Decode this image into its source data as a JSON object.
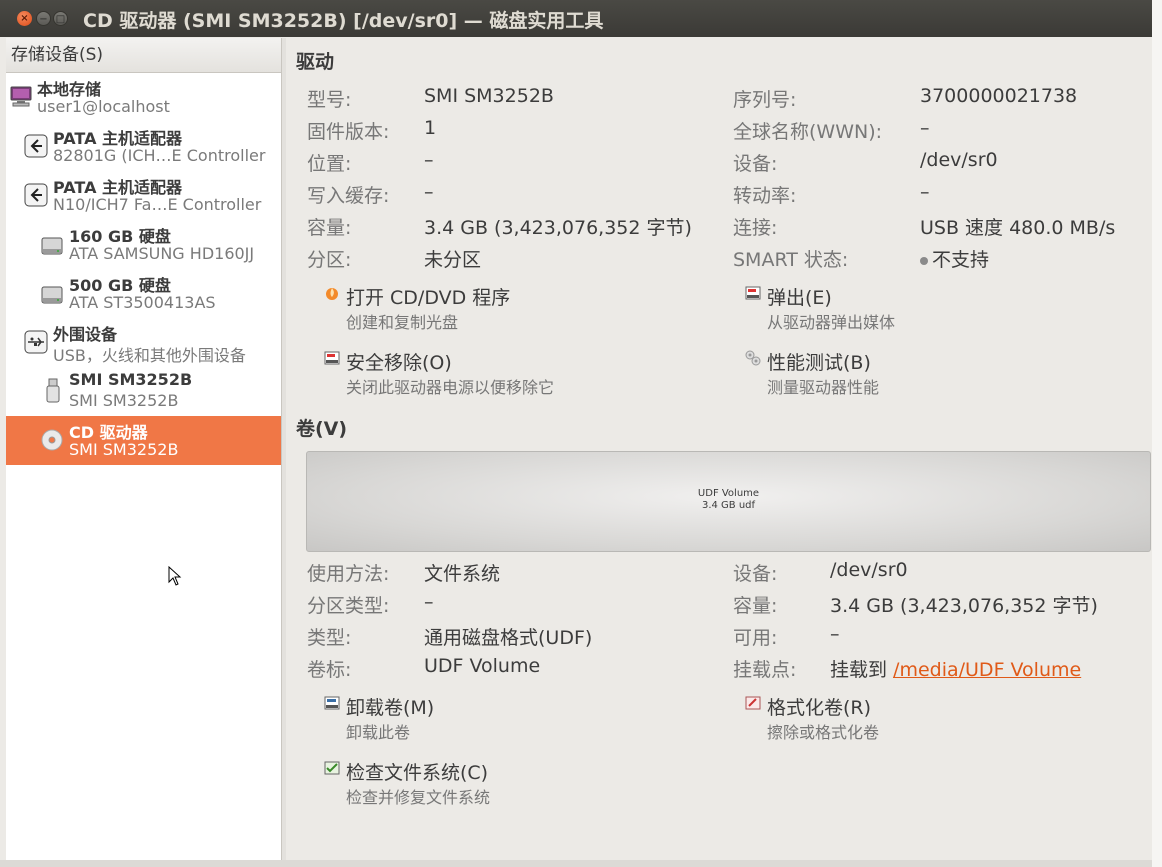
{
  "window": {
    "title": "CD 驱动器 (SMI SM3252B) [/dev/sr0] — 磁盘实用工具",
    "close": "×",
    "min": "−",
    "max": "□"
  },
  "sidebar": {
    "header": "存储设备(S)",
    "items": [
      {
        "title": "本地存储",
        "subtitle": "user1@localhost",
        "icon": "computer-icon"
      },
      {
        "title": "PATA 主机适配器",
        "subtitle": "82801G (ICH…E Controller",
        "icon": "adapter-icon"
      },
      {
        "title": "PATA 主机适配器",
        "subtitle": "N10/ICH7 Fa…E Controller",
        "icon": "adapter-icon"
      },
      {
        "title": "160 GB 硬盘",
        "subtitle": "ATA SAMSUNG HD160JJ",
        "icon": "harddisk-icon"
      },
      {
        "title": "500 GB 硬盘",
        "subtitle": "ATA ST3500413AS",
        "icon": "harddisk-icon"
      },
      {
        "title": "外围设备",
        "subtitle": "USB，火线和其他外围设备",
        "icon": "usb-icon"
      },
      {
        "title": "SMI SM3252B",
        "subtitle": "SMI SM3252B",
        "icon": "usb-stick-icon"
      },
      {
        "title": "CD 驱动器",
        "subtitle": "SMI SM3252B",
        "icon": "cdrom-icon",
        "selected": true
      }
    ]
  },
  "drive": {
    "section_title": "驱动",
    "model_label": "型号:",
    "model": "SMI SM3252B",
    "firmware_label": "固件版本:",
    "firmware": "1",
    "location_label": "位置:",
    "location": "–",
    "write_cache_label": "写入缓存:",
    "write_cache": "–",
    "capacity_label": "容量:",
    "capacity": "3.4 GB (3,423,076,352 字节)",
    "partitioning_label": "分区:",
    "partitioning": "未分区",
    "serial_label": "序列号:",
    "serial": "3700000021738",
    "wwn_label": "全球名称(WWN):",
    "wwn": "–",
    "device_label": "设备:",
    "device": "/dev/sr0",
    "rotation_label": "转动率:",
    "rotation": "–",
    "connection_label": "连接:",
    "connection": "USB 速度 480.0 MB/s",
    "smart_label": "SMART 状态:",
    "smart": "不支持",
    "actions": {
      "open_title": "打开 CD/DVD 程序",
      "open_desc": "创建和复制光盘",
      "eject_title": "弹出(E)",
      "eject_desc": "从驱动器弹出媒体",
      "safe_remove_title": "安全移除(O)",
      "safe_remove_desc": "关闭此驱动器电源以便移除它",
      "benchmark_title": "性能测试(B)",
      "benchmark_desc": "测量驱动器性能"
    }
  },
  "volume": {
    "section_title": "卷(V)",
    "bar_line1": "UDF Volume",
    "bar_line2": "3.4 GB udf",
    "usage_label": "使用方法:",
    "usage": "文件系统",
    "part_type_label": "分区类型:",
    "part_type": "–",
    "type_label": "类型:",
    "type": "通用磁盘格式(UDF)",
    "label_label": "卷标:",
    "label": "UDF Volume",
    "device_label": "设备:",
    "device": "/dev/sr0",
    "capacity_label": "容量:",
    "capacity": "3.4 GB (3,423,076,352 字节)",
    "available_label": "可用:",
    "available": "–",
    "mount_label": "挂载点:",
    "mount_prefix": "挂载到 ",
    "mount_link": "/media/UDF Volume",
    "actions": {
      "unmount_title": "卸载卷(M)",
      "unmount_desc": "卸载此卷",
      "format_title": "格式化卷(R)",
      "format_desc": "擦除或格式化卷",
      "check_title": "检查文件系统(C)",
      "check_desc": "检查并修复文件系统"
    }
  }
}
